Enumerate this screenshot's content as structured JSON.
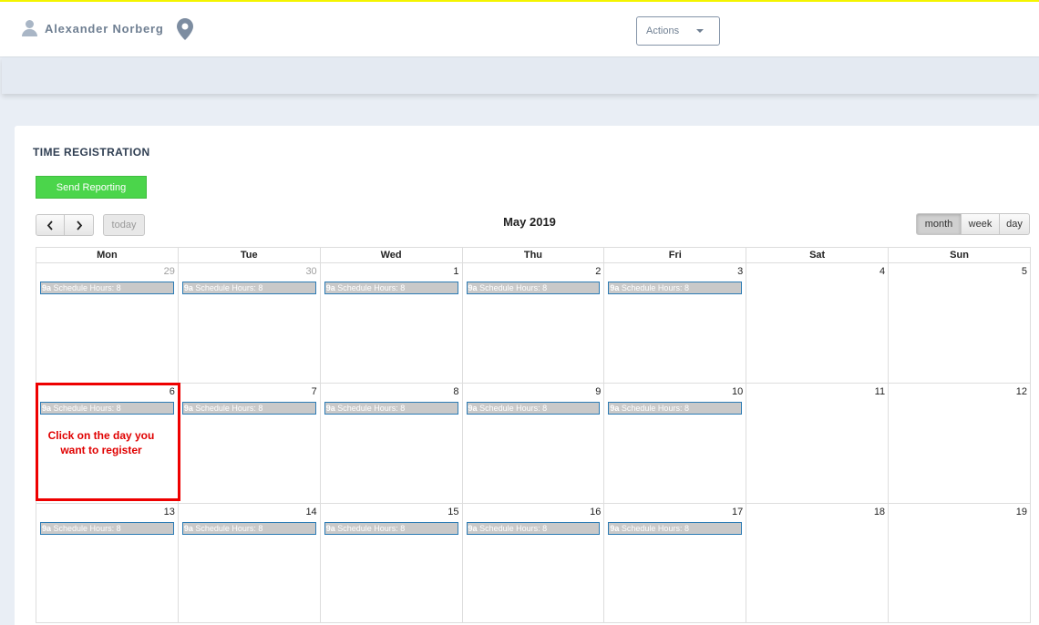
{
  "header": {
    "user_name": "Alexander Norberg",
    "actions_label": "Actions"
  },
  "card": {
    "title": "TIME REGISTRATION",
    "send_label": "Send Reporting"
  },
  "calendar": {
    "title": "May 2019",
    "today_label": "today",
    "views": {
      "month": "month",
      "week": "week",
      "day": "day"
    },
    "active_view": "month",
    "weekdays": [
      "Mon",
      "Tue",
      "Wed",
      "Thu",
      "Fri",
      "Sat",
      "Sun"
    ],
    "weeks": [
      [
        {
          "day": "29",
          "other": true,
          "event": true
        },
        {
          "day": "30",
          "other": true,
          "event": true
        },
        {
          "day": "1",
          "event": true
        },
        {
          "day": "2",
          "event": true
        },
        {
          "day": "3",
          "event": true
        },
        {
          "day": "4",
          "event": false
        },
        {
          "day": "5",
          "event": false
        }
      ],
      [
        {
          "day": "6",
          "event": true
        },
        {
          "day": "7",
          "event": true
        },
        {
          "day": "8",
          "event": true
        },
        {
          "day": "9",
          "event": true
        },
        {
          "day": "10",
          "event": true
        },
        {
          "day": "11",
          "event": false
        },
        {
          "day": "12",
          "event": false
        }
      ],
      [
        {
          "day": "13",
          "event": true
        },
        {
          "day": "14",
          "event": true
        },
        {
          "day": "15",
          "event": true
        },
        {
          "day": "16",
          "event": true
        },
        {
          "day": "17",
          "event": true
        },
        {
          "day": "18",
          "event": false
        },
        {
          "day": "19",
          "event": false
        }
      ]
    ],
    "event_time": "9a",
    "event_title": "Schedule Hours: 8"
  },
  "hint": "Click on the day you want to register",
  "colors": {
    "accent_green": "#4bd54b",
    "highlight_red": "#ee0000",
    "event_border": "#2d7cb5",
    "top_line": "#f4f400"
  }
}
